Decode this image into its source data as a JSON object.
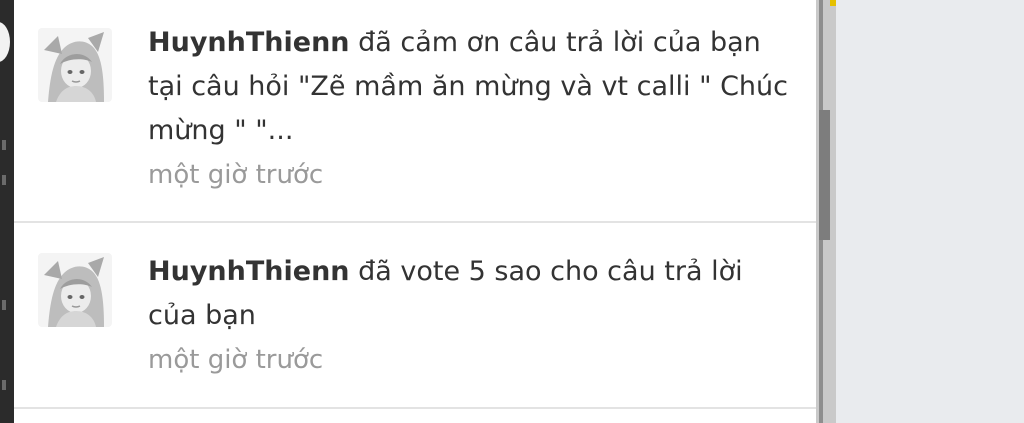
{
  "notifications": [
    {
      "username": "HuynhThienn",
      "message": " đã cảm ơn câu trả lời của bạn tại câu hỏi \"Zẽ mầm ăn mừng và vt calli \" Chúc mừng \" \"...",
      "time": "một giờ trước",
      "avatar_icon": "anime-avatar-icon"
    },
    {
      "username": "HuynhThienn",
      "message": "  đã vote 5 sao cho câu trả lời của bạn",
      "time": "một giờ trước",
      "avatar_icon": "anime-avatar-icon"
    }
  ],
  "colors": {
    "panel_bg": "#ffffff",
    "page_bg": "#e9ebee",
    "username": "#333333",
    "message": "#333333",
    "time": "#9a9a9a",
    "divider": "#e3e3e3"
  }
}
